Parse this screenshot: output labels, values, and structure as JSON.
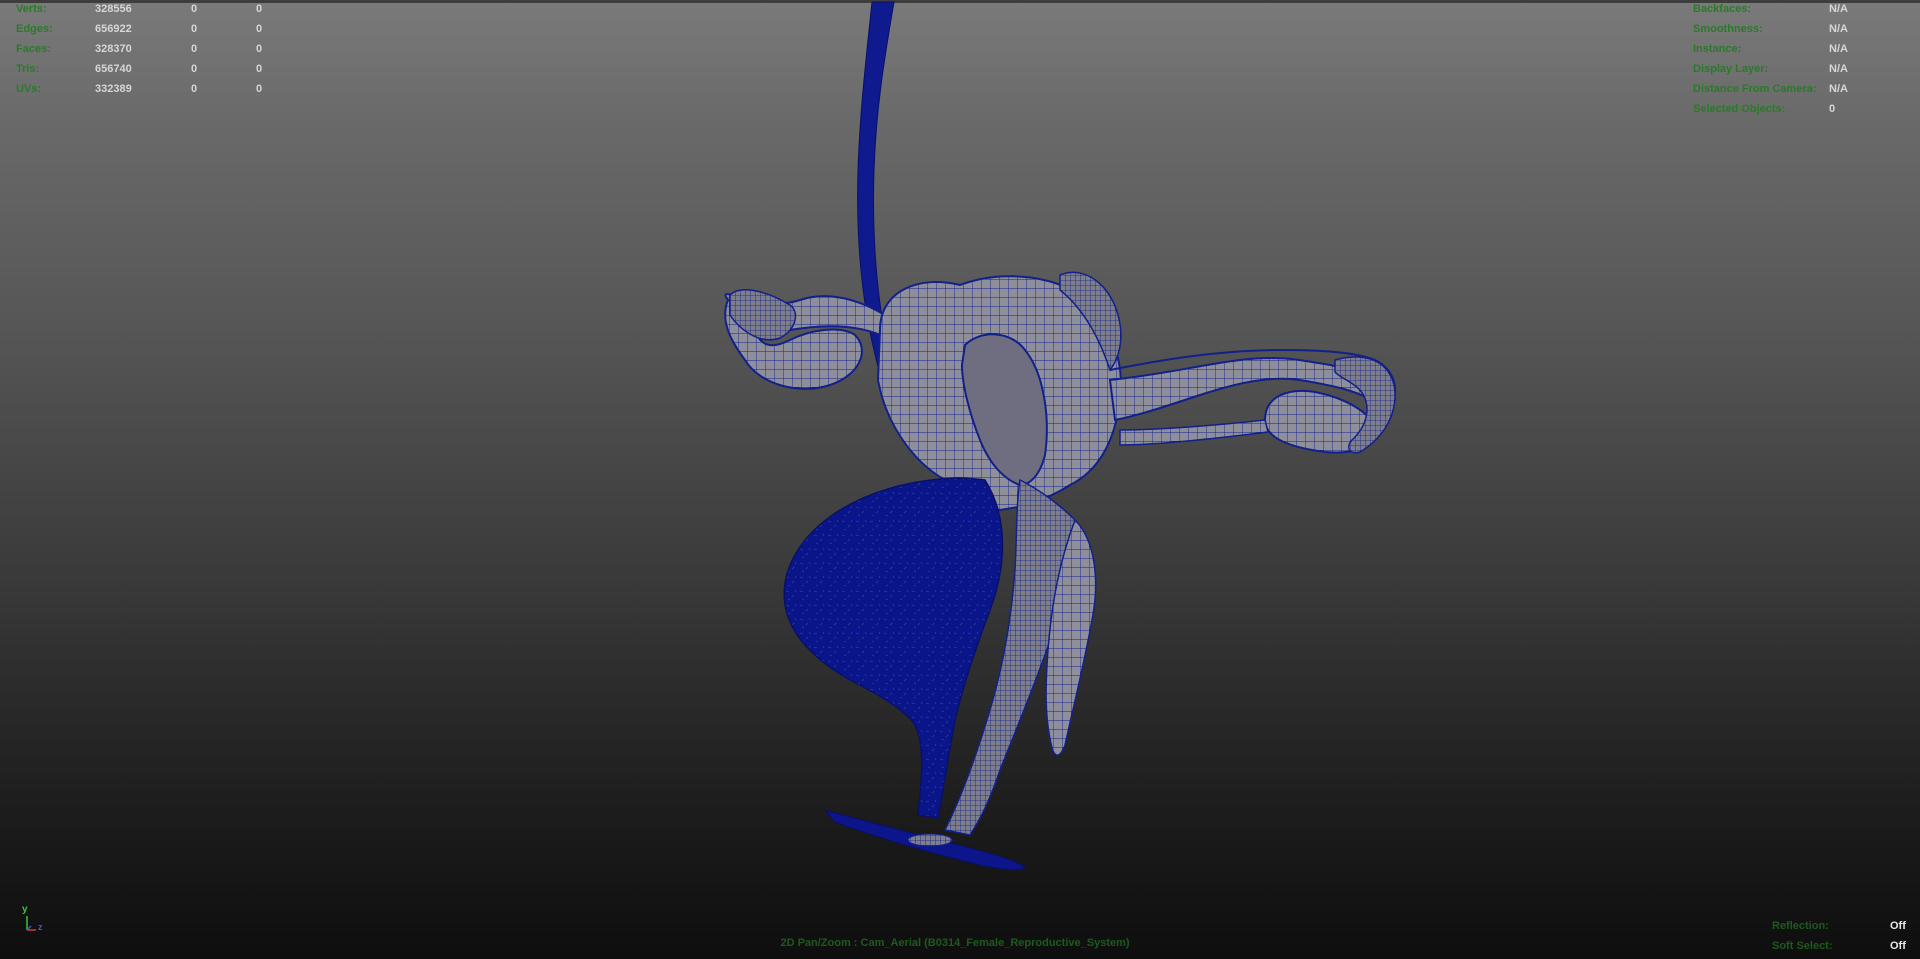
{
  "stats_left": [
    {
      "label": "Verts:",
      "values": [
        "328556",
        "0",
        "0"
      ]
    },
    {
      "label": "Edges:",
      "values": [
        "656922",
        "0",
        "0"
      ]
    },
    {
      "label": "Faces:",
      "values": [
        "328370",
        "0",
        "0"
      ]
    },
    {
      "label": "Tris:",
      "values": [
        "656740",
        "0",
        "0"
      ]
    },
    {
      "label": "UVs:",
      "values": [
        "332389",
        "0",
        "0"
      ]
    }
  ],
  "stats_right": [
    {
      "label": "Backfaces:",
      "value": "N/A"
    },
    {
      "label": "Smoothness:",
      "value": "N/A"
    },
    {
      "label": "Instance:",
      "value": "N/A"
    },
    {
      "label": "Display Layer:",
      "value": "N/A"
    },
    {
      "label": "Distance From Camera:",
      "value": "N/A"
    },
    {
      "label": "Selected Objects:",
      "value": "0"
    }
  ],
  "bottom_right": [
    {
      "label": "Reflection:",
      "value": "Off"
    },
    {
      "label": "Soft Select:",
      "value": "Off"
    }
  ],
  "camera_label": "2D Pan/Zoom : Cam_Aerial (B0314_Female_Reproductive_System)",
  "axis": {
    "y": "y",
    "z": "z"
  },
  "colors": {
    "wire": "#0c1a8c",
    "mesh_fill": "#8e8e9a",
    "hud_label": "#2a7a2a",
    "hud_value": "#d6d6d6",
    "axis_y": "#3cc33c",
    "axis_z": "#3b5ecc",
    "axis_x": "#cc3b3b"
  }
}
